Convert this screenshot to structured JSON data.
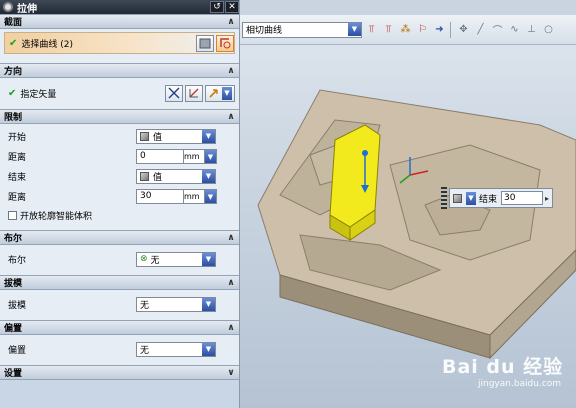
{
  "dialog": {
    "title": "拉伸",
    "reset_symbol": "↺",
    "close_symbol": "✕"
  },
  "sections": {
    "section_curve": {
      "header": "截面",
      "select_curve_label": "选择曲线 (2)"
    },
    "direction": {
      "header": "方向",
      "specify_vector_label": "指定矢量"
    },
    "limits": {
      "header": "限制",
      "start_label": "开始",
      "start_option": "值",
      "start_distance_label": "距离",
      "start_distance_value": "0",
      "end_label": "结束",
      "end_option": "值",
      "end_distance_label": "距离",
      "end_distance_value": "30",
      "unit": "mm",
      "open_profile_label": "开放轮廓智能体积"
    },
    "boolean": {
      "header": "布尔",
      "label": "布尔",
      "value": "无"
    },
    "draft": {
      "header": "拔模",
      "label": "拔模",
      "value": "无"
    },
    "offset": {
      "header": "偏置",
      "label": "偏置",
      "value": "无"
    },
    "settings": {
      "header": "设置"
    }
  },
  "toolbar": {
    "curve_rule": "相切曲线"
  },
  "dynamic_input": {
    "label": "结束",
    "value": "30"
  },
  "watermark": {
    "logo": "Bai du 经验",
    "sub": "jingyan.baidu.com"
  },
  "colors": {
    "check_green": "#17a31a",
    "selection_orange": "#f2d0a0",
    "extrusion_yellow": "#f2ea1d",
    "model_tan": "#cdbfa9"
  }
}
